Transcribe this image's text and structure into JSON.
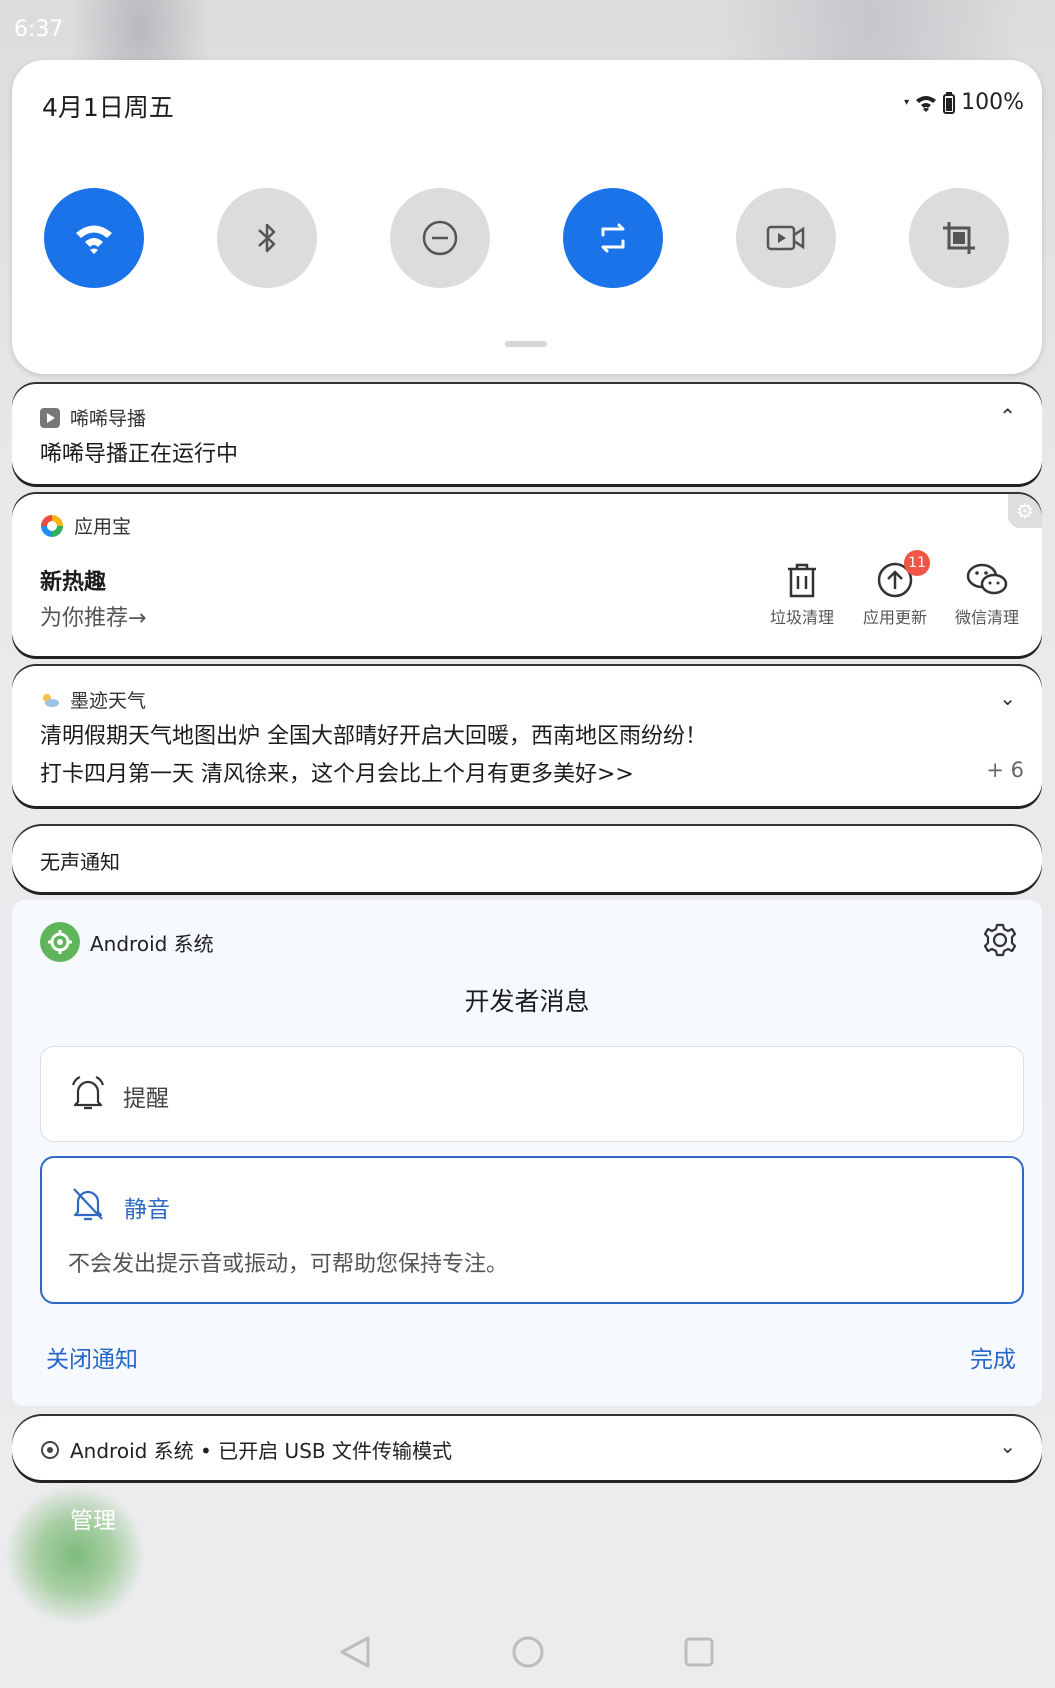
{
  "status": {
    "time": "6:37",
    "battery": "100%"
  },
  "quick_settings": {
    "date": "4月1日周五",
    "tiles": [
      {
        "icon": "wifi-icon",
        "active": true
      },
      {
        "icon": "bluetooth-icon",
        "active": false
      },
      {
        "icon": "do-not-disturb-icon",
        "active": false
      },
      {
        "icon": "auto-rotate-icon",
        "active": true
      },
      {
        "icon": "screen-record-icon",
        "active": false
      },
      {
        "icon": "screenshot-crop-icon",
        "active": false
      }
    ]
  },
  "notifications": {
    "xixi": {
      "app": "唏唏导播",
      "text": "唏唏导播正在运行中"
    },
    "yyb": {
      "app": "应用宝",
      "title": "新热趣",
      "subtitle": "为你推荐→",
      "actions": [
        "垃圾清理",
        "应用更新",
        "微信清理"
      ],
      "update_badge": "11"
    },
    "weather": {
      "app": "墨迹天气",
      "line1": "清明假期天气地图出炉 全国大部晴好开启大回暖，西南地区雨纷纷！",
      "line2": "打卡四月第一天 清风徐来，这个月会比上个月有更多美好>>",
      "more": "+ 6"
    },
    "silent_header": "无声通知",
    "android": {
      "app": "Android 系统",
      "title": "开发者消息",
      "alert_label": "提醒",
      "silent_label": "静音",
      "silent_desc": "不会发出提示音或振动，可帮助您保持专注。",
      "turn_off": "关闭通知",
      "done": "完成"
    },
    "usb": {
      "text": "Android 系统 • 已开启 USB 文件传输模式"
    }
  },
  "manage_label": "管理",
  "colors": {
    "accent": "#1b73ea",
    "link": "#2767c7",
    "badge": "#f05545"
  }
}
